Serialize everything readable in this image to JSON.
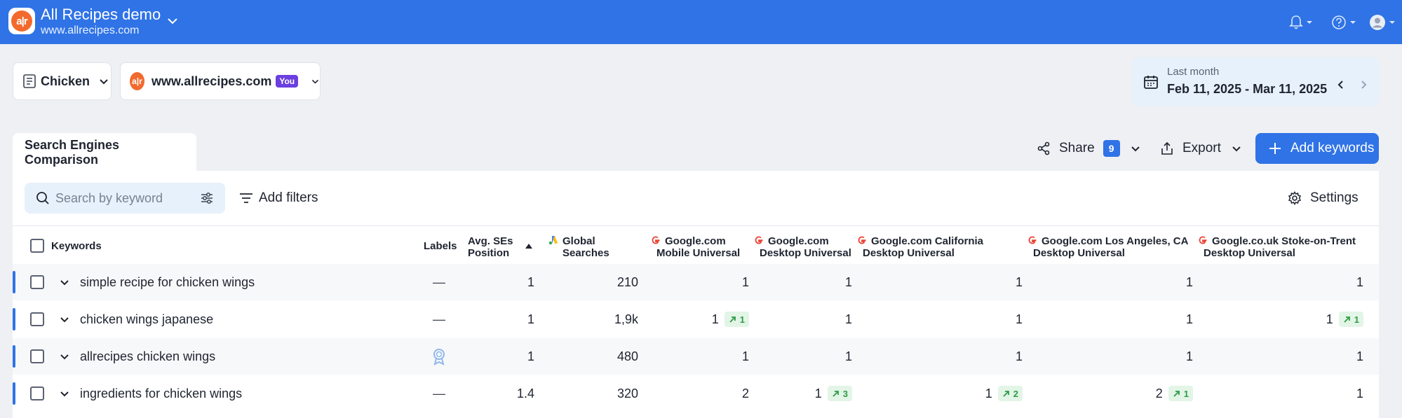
{
  "header": {
    "project_title": "All Recipes demo",
    "project_site": "www.allrecipes.com"
  },
  "filters": {
    "group": "Chicken",
    "site": "www.allrecipes.com",
    "you_badge": "You"
  },
  "date_range": {
    "label": "Last month",
    "value": "Feb 11, 2025 - Mar 11, 2025"
  },
  "tabs": [
    {
      "label": "Search Engines Comparison"
    }
  ],
  "actions": {
    "share": "Share",
    "share_count": "9",
    "export": "Export",
    "add_keywords": "Add keywords"
  },
  "toolbar": {
    "search_placeholder": "Search by keyword",
    "add_filters": "Add filters",
    "settings": "Settings"
  },
  "table": {
    "headers": {
      "keywords": "Keywords",
      "labels": "Labels",
      "avg_line1": "Avg. SEs",
      "avg_line2": "Position",
      "global_line1": "Global",
      "global_line2": "Searches",
      "se1_line1": "Google.com",
      "se1_line2": "Mobile Universal",
      "se2_line1": "Google.com",
      "se2_line2": "Desktop Universal",
      "se3_line1": "Google.com California",
      "se3_line2": "Desktop Universal",
      "se4_line1": "Google.com Los Angeles, CA",
      "se4_line2": "Desktop Universal",
      "se5_line1": "Google.co.uk Stoke-on-Trent",
      "se5_line2": "Desktop Universal"
    },
    "rows": [
      {
        "keyword": "simple recipe for chicken wings",
        "label": "—",
        "avg": "1",
        "searches": "210",
        "se1": "1",
        "se1_delta": "",
        "se2": "1",
        "se2_delta": "",
        "se3": "1",
        "se3_delta": "",
        "se4": "1",
        "se4_delta": "",
        "se5": "1",
        "se5_delta": ""
      },
      {
        "keyword": "chicken wings japanese",
        "label": "—",
        "avg": "1",
        "searches": "1,9k",
        "se1": "1",
        "se1_delta": "1",
        "se2": "1",
        "se2_delta": "",
        "se3": "1",
        "se3_delta": "",
        "se4": "1",
        "se4_delta": "",
        "se5": "1",
        "se5_delta": "1"
      },
      {
        "keyword": "allrecipes chicken wings",
        "label": "",
        "avg": "1",
        "searches": "480",
        "se1": "1",
        "se1_delta": "",
        "se2": "1",
        "se2_delta": "",
        "se3": "1",
        "se3_delta": "",
        "se4": "1",
        "se4_delta": "",
        "se5": "1",
        "se5_delta": ""
      },
      {
        "keyword": "ingredients for chicken wings",
        "label": "—",
        "avg": "1.4",
        "searches": "320",
        "se1": "2",
        "se1_delta": "",
        "se2": "1",
        "se2_delta": "3",
        "se3": "1",
        "se3_delta": "2",
        "se4": "2",
        "se4_delta": "1",
        "se5": "1",
        "se5_delta": ""
      }
    ]
  },
  "colors": {
    "brand_blue": "#2f73e6",
    "positive_green": "#2e9c47",
    "you_purple": "#6b3fe0"
  },
  "icons": [
    "bell-icon",
    "help-icon",
    "avatar-icon",
    "calendar-icon",
    "share-icon",
    "export-icon",
    "plus-icon",
    "search-icon",
    "filter-sliders-icon",
    "filter-lines-icon",
    "gear-icon",
    "google-ads-icon",
    "google-icon",
    "award-icon"
  ]
}
